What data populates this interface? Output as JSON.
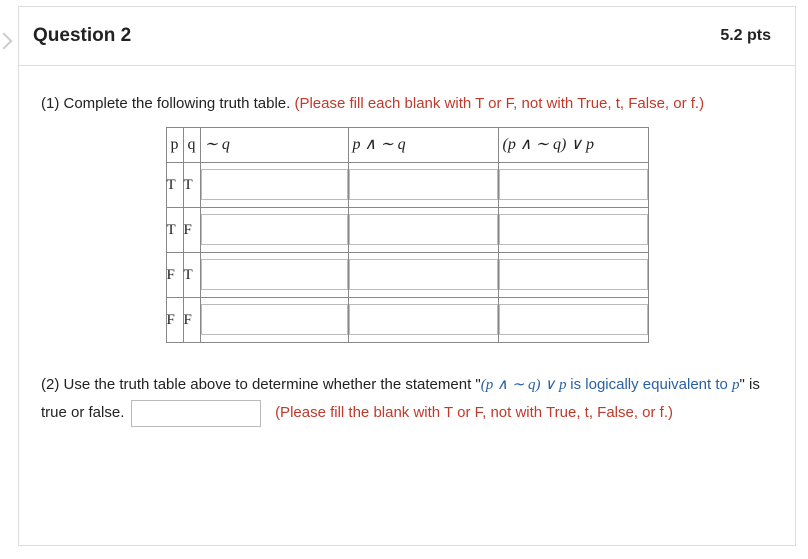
{
  "header": {
    "title": "Question 2",
    "points": "5.2 pts"
  },
  "q1": {
    "prefix": "(1) Complete the following truth table. ",
    "instruction": "(Please fill each blank with T or F, not with True, t, False, or f.)"
  },
  "table": {
    "headers": {
      "p": "p",
      "q": "q",
      "notq": "∼ q",
      "pandnotq": "p ∧ ∼ q",
      "final": "(p ∧ ∼ q) ∨ p"
    },
    "rows": [
      {
        "p": "T",
        "q": "T"
      },
      {
        "p": "T",
        "q": "F"
      },
      {
        "p": "F",
        "q": "T"
      },
      {
        "p": "F",
        "q": "F"
      }
    ]
  },
  "q2": {
    "prefix": "(2)  Use the truth table above to determine whether the statement \"",
    "expr": "(p ∧ ∼ q) ∨ p ",
    "mid1": "is logically equivalent to ",
    "p": "p",
    "mid2": "\" is true or false.   ",
    "instruction": "(Please fill the blank with T or F, not with True, t, False, or f.)"
  }
}
